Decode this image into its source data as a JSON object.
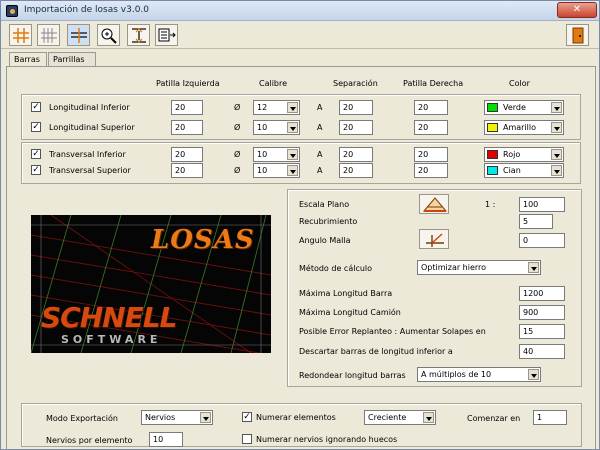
{
  "window": {
    "title": "Importación de losas   v3.0.0",
    "close": "✕"
  },
  "tabs": [
    "Barras",
    "Parrillas"
  ],
  "grid": {
    "headers": {
      "patilla_izq": "Patilla Izquierda",
      "calibre": "Calibre",
      "separacion": "Separación",
      "patilla_der": "Patilla Derecha",
      "color": "Color"
    },
    "diam_symbol": "Ø",
    "sep_symbol": "A",
    "rows": [
      {
        "label": "Longitudinal Inferior",
        "checked": "✓",
        "patilla_izq": "20",
        "calibre": "12",
        "separacion": "20",
        "patilla_der": "20",
        "color_name": "Verde",
        "color_hex": "#00e000"
      },
      {
        "label": "Longitudinal Superior",
        "checked": "✓",
        "patilla_izq": "20",
        "calibre": "10",
        "separacion": "20",
        "patilla_der": "20",
        "color_name": "Amarillo",
        "color_hex": "#f2f200"
      },
      {
        "label": "Transversal Inferior",
        "checked": "✓",
        "patilla_izq": "20",
        "calibre": "10",
        "separacion": "20",
        "patilla_der": "20",
        "color_name": "Rojo",
        "color_hex": "#e00000"
      },
      {
        "label": "Transversal Superior",
        "checked": "✓",
        "patilla_izq": "20",
        "calibre": "10",
        "separacion": "20",
        "patilla_der": "20",
        "color_name": "Cian",
        "color_hex": "#00e8e8"
      }
    ]
  },
  "logo": {
    "title": "LOSAS",
    "brand": "SCHNELL",
    "sub": "SOFTWARE"
  },
  "settings": {
    "escala_label": "Escala Plano",
    "escala_prefix": "1 :",
    "escala_value": "100",
    "recubrimiento_label": "Recubrimiento",
    "recubrimiento_value": "5",
    "angulo_label": "Angulo Malla",
    "angulo_value": "0",
    "metodo_label": "Método de cálculo",
    "metodo_value": "Optimizar hierro",
    "max_barra_label": "Máxima Longitud Barra",
    "max_barra_value": "1200",
    "max_camion_label": "Máxima Longitud Camión",
    "max_camion_value": "900",
    "error_label": "Posible Error Replanteo : Aumentar Solapes en",
    "error_value": "15",
    "descartar_label": "Descartar barras de longitud inferior a",
    "descartar_value": "40",
    "redondear_label": "Redondear longitud barras",
    "redondear_value": "A múltiplos de 10"
  },
  "export": {
    "modo_label": "Modo Exportación",
    "modo_value": "Nervios",
    "numerar_label": "Numerar elementos",
    "numerar_checked": "✓",
    "orden_value": "Creciente",
    "comenzar_label": "Comenzar en",
    "comenzar_value": "1",
    "nervios_label": "Nervios por elemento",
    "nervios_value": "10",
    "ignorar_label": "Numerar nervios ignorando huecos"
  }
}
